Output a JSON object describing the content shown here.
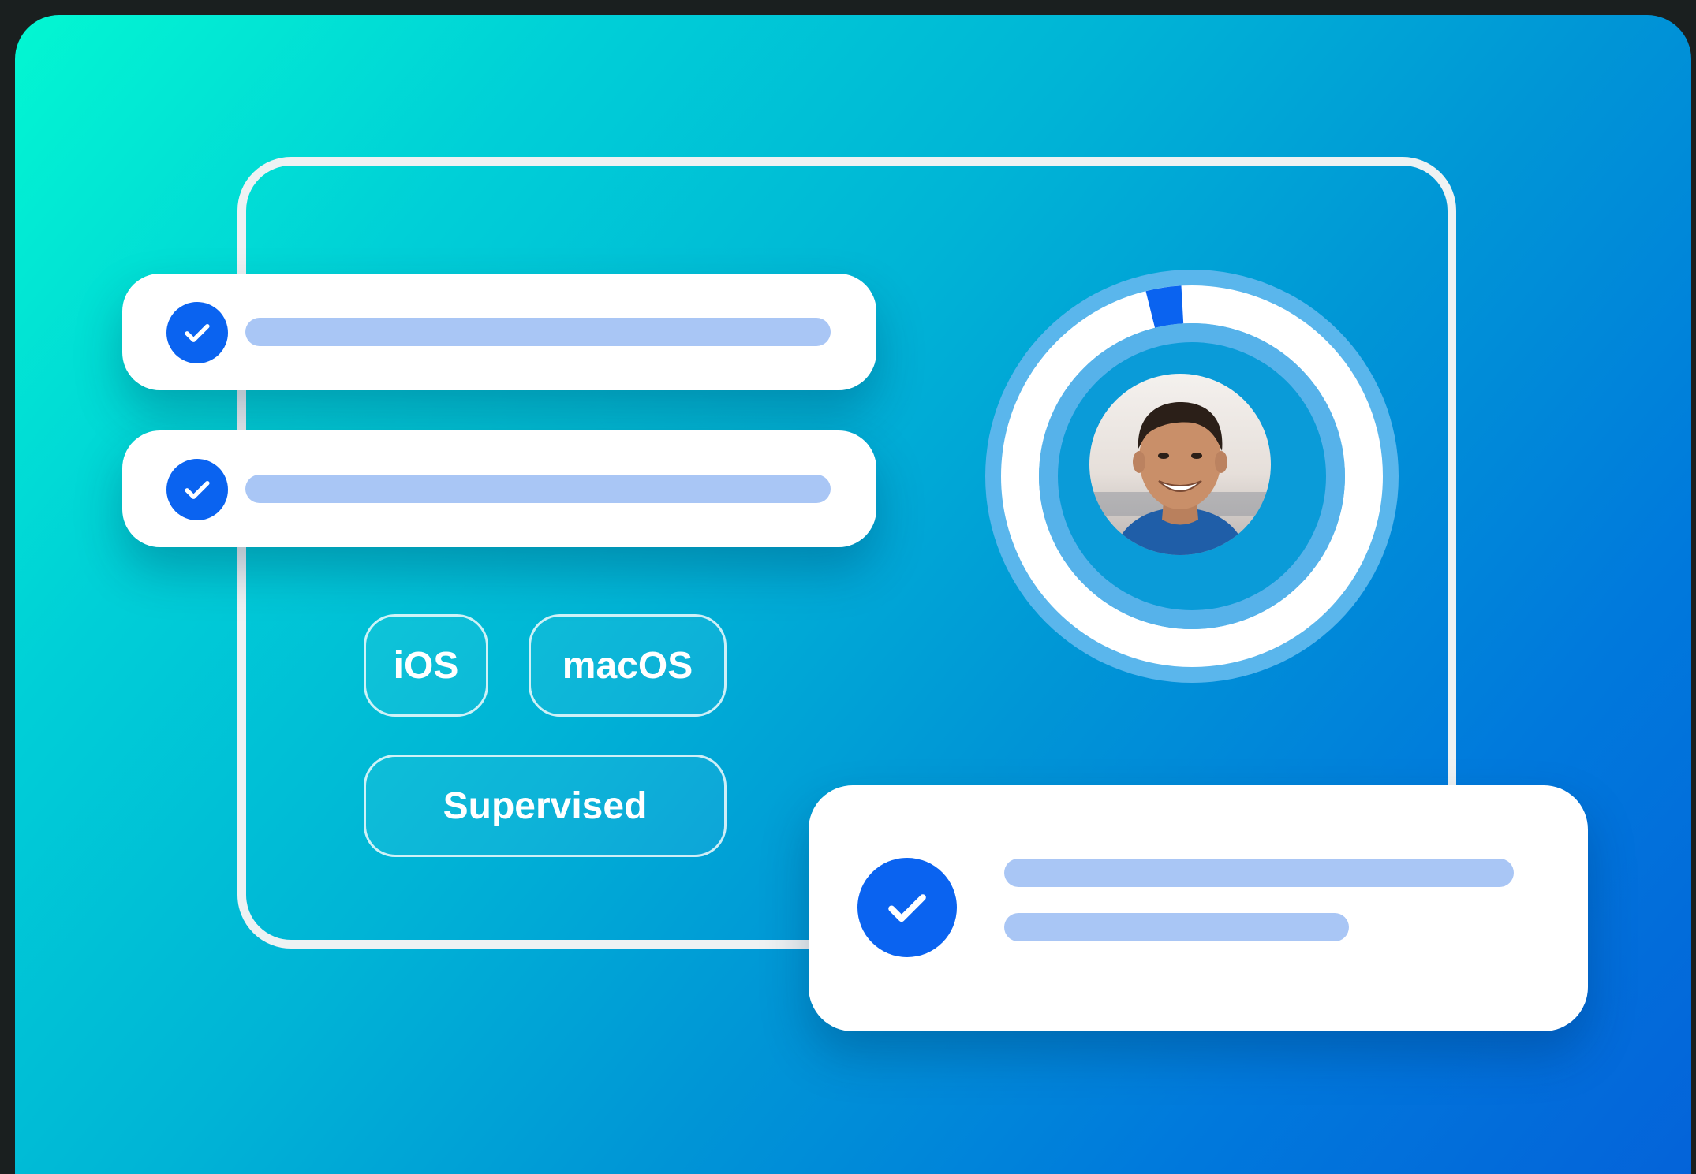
{
  "tags": {
    "ios": "iOS",
    "macos": "macOS",
    "supervised": "Supervised"
  },
  "progress": {
    "value": 0.03,
    "track_color": "#ffffff",
    "fill_color": "#0a63f0"
  },
  "colors": {
    "check": "#0a63f0",
    "placeholder_bar": "#a9c6f5",
    "gradient_start": "#03f7d2",
    "gradient_end": "#0463d9"
  },
  "icons": {
    "check": "check-circle-icon",
    "avatar": "user-avatar"
  }
}
